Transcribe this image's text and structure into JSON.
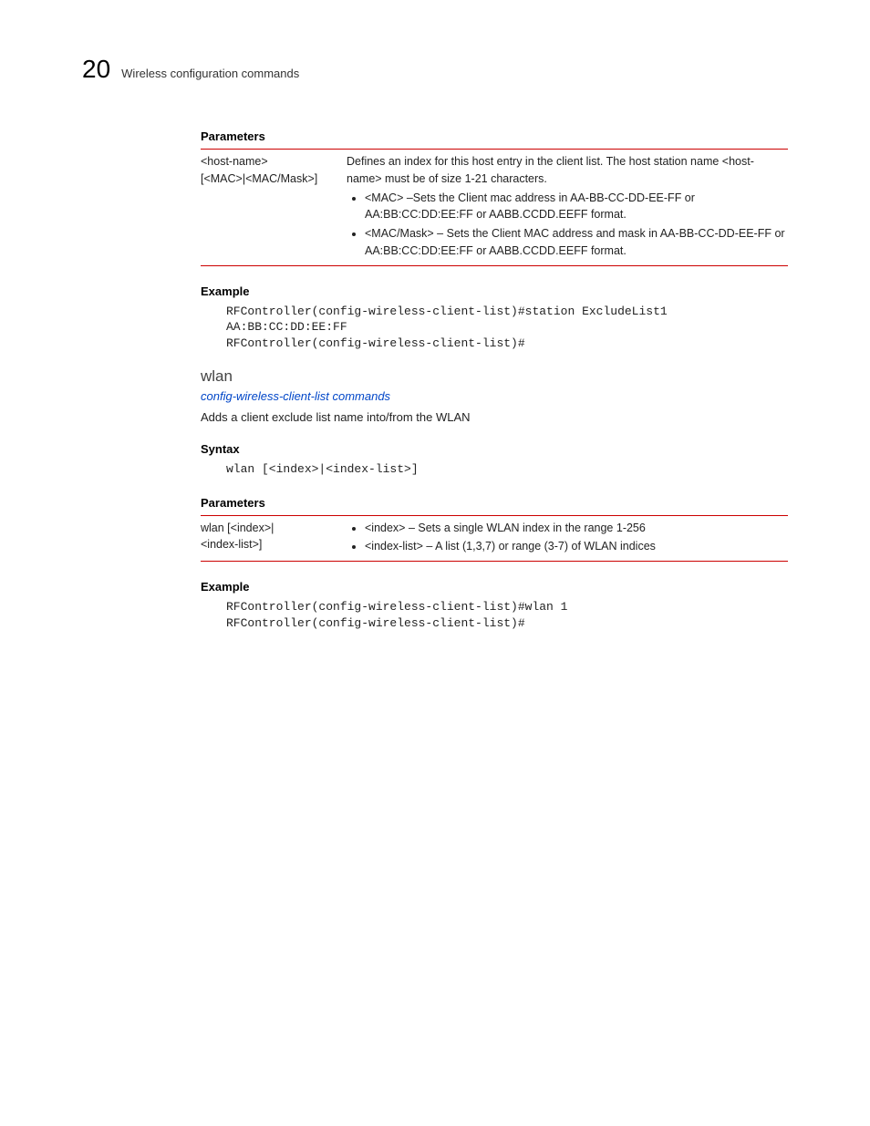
{
  "header": {
    "chapter_number": "20",
    "chapter_title": "Wireless configuration commands"
  },
  "sections": {
    "params1_label": "Parameters",
    "params1": {
      "col1_line1": "<host-name>",
      "col1_line2": "[<MAC>|<MAC/Mask>]",
      "intro": "Defines an index for this host entry in the client list. The host station name <host-name> must be of size 1-21 characters.",
      "bullet1": "<MAC> –Sets the Client mac address in AA-BB-CC-DD-EE-FF or AA:BB:CC:DD:EE:FF or AABB.CCDD.EEFF format.",
      "bullet2": "<MAC/Mask> – Sets the Client MAC address and mask in AA-BB-CC-DD-EE-FF or AA:BB:CC:DD:EE:FF or AABB.CCDD.EEFF format."
    },
    "example1_label": "Example",
    "example1_code": "RFController(config-wireless-client-list)#station ExcludeList1 \nAA:BB:CC:DD:EE:FF\nRFController(config-wireless-client-list)#",
    "wlan_heading": "wlan",
    "link_text": "config-wireless-client-list commands",
    "wlan_desc": "Adds a client exclude list name into/from the WLAN",
    "syntax_label": "Syntax",
    "syntax_code": "wlan [<index>|<index-list>]",
    "params2_label": "Parameters",
    "params2": {
      "col1_line1": "wlan [<index>|",
      "col1_line2": "<index-list>]",
      "bullet1": "<index> – Sets a single WLAN index in the range 1-256",
      "bullet2": "<index-list> – A list (1,3,7) or range (3-7) of WLAN indices"
    },
    "example2_label": "Example",
    "example2_code": "RFController(config-wireless-client-list)#wlan 1\nRFController(config-wireless-client-list)#"
  }
}
